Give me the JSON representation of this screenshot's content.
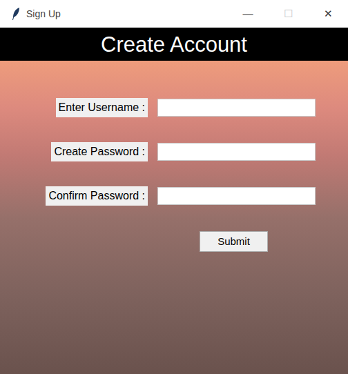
{
  "window": {
    "title": "Sign Up",
    "controls": [
      {
        "glyph": "—",
        "disabled": false
      },
      {
        "glyph": "☐",
        "disabled": true
      },
      {
        "glyph": "✕",
        "disabled": false
      }
    ]
  },
  "header": {
    "title": "Create Account"
  },
  "fields": [
    {
      "label": "Enter Username :"
    },
    {
      "label": "Create Password :"
    },
    {
      "label": "Confirm Password :"
    }
  ],
  "buttons": [
    "Submit"
  ]
}
